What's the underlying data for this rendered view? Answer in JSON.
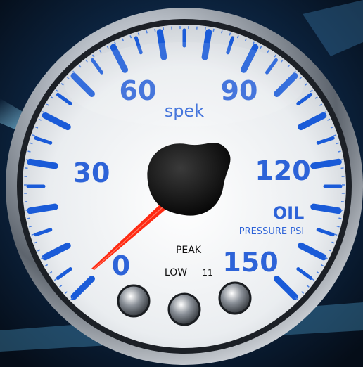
{
  "gauge": {
    "brand": "spek",
    "dial_numbers": [
      "0",
      "30",
      "60",
      "90",
      "120",
      "150"
    ],
    "label_line1": "OIL",
    "label_line2": "PRESSURE PSI",
    "peak_label": "PEAK",
    "low_label": "LOW",
    "low_value": "11",
    "needle_value": 0,
    "range": [
      0,
      150
    ],
    "buttons": 3
  },
  "colors": {
    "background": "#0b1d33",
    "streak": "#7fd0f5",
    "bezel": "#c9ced4",
    "face": "#eef0f2",
    "tick_blue": "#1a5bd8",
    "numeral_blue": "#2d63d8",
    "needle": "#ff2a12",
    "hub": "#0d0d0d"
  }
}
